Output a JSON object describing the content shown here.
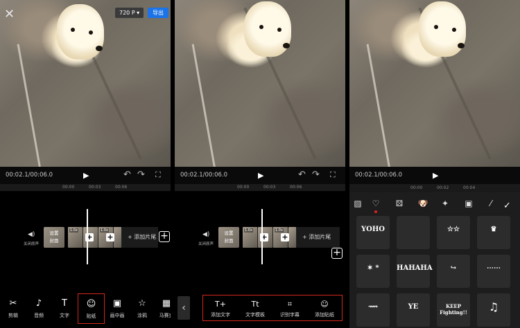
{
  "panel1": {
    "close_icon": "close-x-icon",
    "resolution": "720 P ▾",
    "export_label": "导出",
    "time": "00:02.1/00:06.0",
    "ruler": [
      "00:00",
      "00:03",
      "00:06"
    ],
    "sound_label": "关闭原声",
    "cover_label": "设置\n封面",
    "clip_speed": "1.0x",
    "add_tail": "+ 添加片尾",
    "toolbar": [
      {
        "icon": "✂",
        "label": "剪辑"
      },
      {
        "icon": "♪",
        "label": "音频"
      },
      {
        "icon": "T",
        "label": "文字"
      },
      {
        "icon": "☺",
        "label": "贴纸",
        "active": true
      },
      {
        "icon": "▣",
        "label": "画中画"
      },
      {
        "icon": "☆",
        "label": "涂鸦"
      },
      {
        "icon": "▦",
        "label": "马赛克"
      }
    ]
  },
  "panel2": {
    "time": "00:02.1/00:06.0",
    "ruler": [
      "00:00",
      "00:03",
      "00:06"
    ],
    "sound_label": "关闭原声",
    "cover_label": "设置\n封面",
    "clip_speed": "1.0x",
    "add_tail": "+ 添加片尾",
    "back_icon": "‹",
    "text_tools": [
      {
        "icon": "T+",
        "label": "添加文字"
      },
      {
        "icon": "Tt",
        "label": "文字模板"
      },
      {
        "icon": "⌗",
        "label": "识别字幕"
      },
      {
        "icon": "☺",
        "label": "添加贴纸"
      }
    ]
  },
  "panel3": {
    "time": "00:02.1/00:06.0",
    "ruler": [
      "00:00",
      "00:02",
      "00:04"
    ],
    "categories": [
      "image-icon",
      "heart-icon",
      "dice-icon",
      "dog-icon",
      "sparkle-icon",
      "camera-icon",
      "pen-icon"
    ],
    "confirm_icon": "check-icon",
    "stickers": [
      {
        "text": "YOHO"
      },
      {
        "text": ""
      },
      {
        "text": "☆☆"
      },
      {
        "text": "♛"
      },
      {
        "text": "✶ *"
      },
      {
        "text": "HAHAHA"
      },
      {
        "text": "↪"
      },
      {
        "text": "⋯⋯"
      },
      {
        "text": "⟿"
      },
      {
        "text": "YE"
      },
      {
        "text": "KEEP Fighting!!"
      },
      {
        "text": "♫"
      }
    ]
  }
}
